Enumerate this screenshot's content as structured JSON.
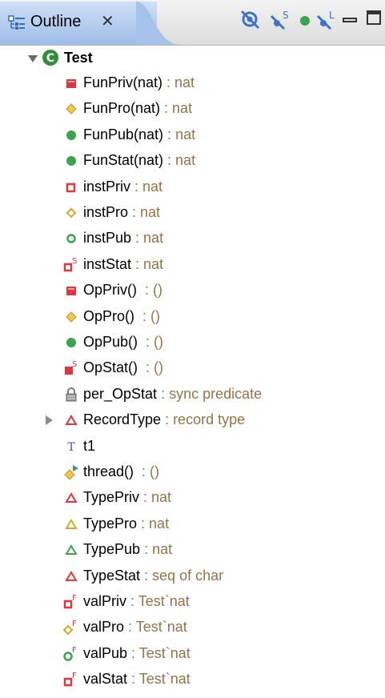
{
  "header": {
    "title": "Outline",
    "close_glyph": "✕"
  },
  "toolbar": [
    {
      "name": "hide-fields-icon"
    },
    {
      "name": "hide-static-icon"
    },
    {
      "name": "hide-non-public-icon"
    },
    {
      "name": "hide-local-types-icon"
    }
  ],
  "tree": {
    "root": "Test",
    "items": [
      {
        "name": "FunPriv(nat)",
        "type": " : nat",
        "icon": "private-function-icon"
      },
      {
        "name": "FunPro(nat)",
        "type": " : nat",
        "icon": "protected-function-icon"
      },
      {
        "name": "FunPub(nat)",
        "type": " : nat",
        "icon": "public-function-icon"
      },
      {
        "name": "FunStat(nat)",
        "type": " : nat",
        "icon": "static-function-icon"
      },
      {
        "name": "instPriv",
        "type": " : nat",
        "icon": "private-instance-variable-icon"
      },
      {
        "name": "instPro",
        "type": " : nat",
        "icon": "protected-instance-variable-icon"
      },
      {
        "name": "instPub",
        "type": " : nat",
        "icon": "public-instance-variable-icon"
      },
      {
        "name": "instStat",
        "type": " : nat",
        "icon": "static-instance-variable-icon"
      },
      {
        "name": "OpPriv()",
        "type": "  : ()",
        "icon": "private-operation-icon"
      },
      {
        "name": "OpPro()",
        "type": "  : ()",
        "icon": "protected-operation-icon"
      },
      {
        "name": "OpPub()",
        "type": "  : ()",
        "icon": "public-operation-icon"
      },
      {
        "name": "OpStat()",
        "type": "  : ()",
        "icon": "static-operation-icon"
      },
      {
        "name": "per_OpStat",
        "type": " : sync predicate",
        "icon": "lock-icon"
      },
      {
        "name": "RecordType",
        "type": " : record type",
        "icon": "record-type-icon"
      },
      {
        "name": "t1",
        "type": "",
        "icon": "trace-icon"
      },
      {
        "name": "thread()",
        "type": "  : ()",
        "icon": "thread-icon"
      },
      {
        "name": "TypePriv",
        "type": " : nat",
        "icon": "private-type-icon"
      },
      {
        "name": "TypePro",
        "type": " : nat",
        "icon": "protected-type-icon"
      },
      {
        "name": "TypePub",
        "type": " : nat",
        "icon": "public-type-icon"
      },
      {
        "name": "TypeStat",
        "type": " : seq of char",
        "icon": "static-type-icon"
      },
      {
        "name": "valPriv",
        "type": " : Test`nat",
        "icon": "private-value-icon"
      },
      {
        "name": "valPro",
        "type": " : Test`nat",
        "icon": "protected-value-icon"
      },
      {
        "name": "valPub",
        "type": " : Test`nat",
        "icon": "public-value-icon"
      },
      {
        "name": "valStat",
        "type": " : Test`nat",
        "icon": "static-value-icon"
      }
    ]
  },
  "icon_glyphs": {
    "static_marker": "S",
    "final_marker": "F",
    "trace_letter": "T"
  },
  "colors": {
    "private": "#e0363f",
    "protected": "#e6b22e",
    "public": "#3aa44e",
    "type_text": "#967346",
    "tab_active": "#b8cff1"
  }
}
